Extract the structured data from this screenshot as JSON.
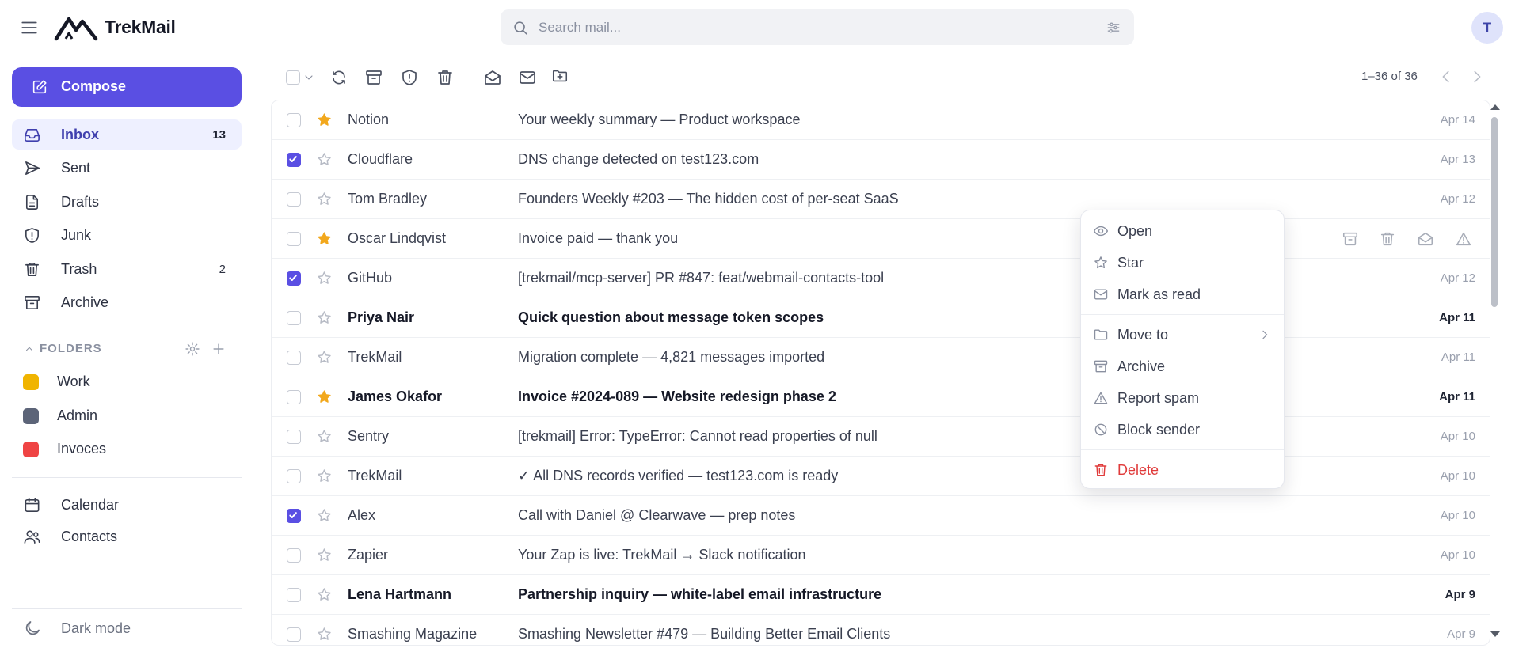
{
  "app": {
    "name": "TrekMail",
    "user_initial": "T"
  },
  "search": {
    "placeholder": "Search mail..."
  },
  "sidebar": {
    "compose_label": "Compose",
    "nav": [
      {
        "label": "Inbox",
        "count": "13",
        "icon": "inbox-icon",
        "active": true
      },
      {
        "label": "Sent",
        "count": "",
        "icon": "send-icon"
      },
      {
        "label": "Drafts",
        "count": "",
        "icon": "document-icon"
      },
      {
        "label": "Junk",
        "count": "",
        "icon": "shield-alert-icon"
      },
      {
        "label": "Trash",
        "count": "2",
        "icon": "trash-icon"
      },
      {
        "label": "Archive",
        "count": "",
        "icon": "archive-icon"
      }
    ],
    "folders_header": "FOLDERS",
    "folders": [
      {
        "name": "Work",
        "color": "#f0b400"
      },
      {
        "name": "Admin",
        "color": "#5c6478"
      },
      {
        "name": "Invoces",
        "color": "#ef4444"
      }
    ],
    "apps": [
      {
        "label": "Calendar",
        "icon": "calendar-icon"
      },
      {
        "label": "Contacts",
        "icon": "users-icon"
      }
    ],
    "dark_mode_label": "Dark mode"
  },
  "toolbar": {
    "pagination": "1–36 of 36"
  },
  "emails": [
    {
      "sender": "Notion",
      "subject": "Your weekly summary — Product workspace",
      "date": "Apr 14",
      "starred": true,
      "checked": false,
      "unread": false
    },
    {
      "sender": "Cloudflare",
      "subject": "DNS change detected on test123.com",
      "date": "Apr 13",
      "starred": false,
      "checked": true,
      "unread": false
    },
    {
      "sender": "Tom Bradley",
      "subject": "Founders Weekly #203 — The hidden cost of per-seat SaaS",
      "date": "Apr 12",
      "starred": false,
      "checked": false,
      "unread": false
    },
    {
      "sender": "Oscar Lindqvist",
      "subject": "Invoice paid — thank you",
      "date": "",
      "starred": true,
      "checked": false,
      "unread": false,
      "hover": true
    },
    {
      "sender": "GitHub",
      "subject": "[trekmail/mcp-server] PR #847: feat/webmail-contacts-tool",
      "date": "Apr 12",
      "starred": false,
      "checked": true,
      "unread": false
    },
    {
      "sender": "Priya Nair",
      "subject": "Quick question about message token scopes",
      "date": "Apr 11",
      "starred": false,
      "checked": false,
      "unread": true
    },
    {
      "sender": "TrekMail",
      "subject": "Migration complete — 4,821 messages imported",
      "date": "Apr 11",
      "starred": false,
      "checked": false,
      "unread": false
    },
    {
      "sender": "James Okafor",
      "subject": "Invoice #2024-089 — Website redesign phase 2",
      "date": "Apr 11",
      "starred": true,
      "checked": false,
      "unread": true
    },
    {
      "sender": "Sentry",
      "subject": "[trekmail] Error: TypeError: Cannot read properties of null",
      "date": "Apr 10",
      "starred": false,
      "checked": false,
      "unread": false
    },
    {
      "sender": "TrekMail",
      "subject": "✓ All DNS records verified — test123.com is ready",
      "date": "Apr 10",
      "starred": false,
      "checked": false,
      "unread": false
    },
    {
      "sender": "Alex",
      "subject": "Call with Daniel @ Clearwave — prep notes",
      "date": "Apr 10",
      "starred": false,
      "checked": true,
      "unread": false
    },
    {
      "sender": "Zapier",
      "subject": "Your Zap is live: TrekMail → Slack notification",
      "date": "Apr 10",
      "starred": false,
      "checked": false,
      "unread": false
    },
    {
      "sender": "Lena Hartmann",
      "subject": "Partnership inquiry — white-label email infrastructure",
      "date": "Apr 9",
      "starred": false,
      "checked": false,
      "unread": true
    },
    {
      "sender": "Smashing Magazine",
      "subject": "Smashing Newsletter #479 — Building Better Email Clients",
      "date": "Apr 9",
      "starred": false,
      "checked": false,
      "unread": false
    }
  ],
  "context_menu": {
    "items": [
      {
        "label": "Open",
        "icon": "eye-icon"
      },
      {
        "label": "Star",
        "icon": "star-icon"
      },
      {
        "label": "Mark as read",
        "icon": "envelope-icon"
      },
      {
        "label": "Move to",
        "icon": "folder-icon",
        "submenu": true
      },
      {
        "label": "Archive",
        "icon": "archive-icon"
      },
      {
        "label": "Report spam",
        "icon": "warning-icon"
      },
      {
        "label": "Block sender",
        "icon": "block-icon"
      },
      {
        "label": "Delete",
        "icon": "trash-icon",
        "danger": true
      }
    ]
  },
  "colors": {
    "accent": "#5a4fe3",
    "star": "#f2a81d",
    "danger": "#e03b3b",
    "active_bg": "#eef0ff"
  }
}
